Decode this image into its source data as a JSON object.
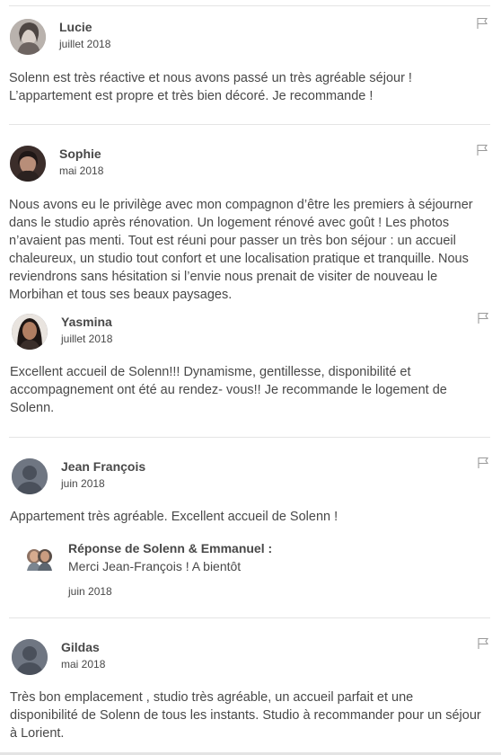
{
  "reviews": [
    {
      "name": "Lucie",
      "date": "juillet 2018",
      "avatar_icon": "user-photo-icon",
      "lines": [
        "Solenn est très réactive et nous avons passé un très agréable séjour !",
        "L’appartement est propre et très bien décoré. Je recommande !"
      ]
    },
    {
      "name": "Sophie",
      "date": "mai 2018",
      "avatar_icon": "user-photo-icon",
      "lines": [
        "Nous avons eu le privilège avec mon compagnon d’être les premiers à séjourner",
        "dans le studio après rénovation. Un logement rénové avec goût ! Les photos",
        "n’avaient pas menti. Tout est réuni pour passer un très bon séjour : un accueil",
        "chaleureux, un studio tout confort et une localisation pratique et tranquille. Nous",
        "reviendrons sans hésitation si l’envie nous prenait de visiter de nouveau le",
        "Morbihan et tous ses beaux paysages."
      ]
    },
    {
      "name": "Yasmina",
      "date": "juillet 2018",
      "avatar_icon": "user-photo-icon",
      "lines": [
        "Excellent accueil de Solenn!!! Dynamisme, gentillesse, disponibilité et",
        "accompagnement ont été au rendez- vous!! Je recommande le logement de",
        "Solenn."
      ]
    },
    {
      "name": "Jean François",
      "date": "juin 2018",
      "avatar_icon": "default-avatar-icon",
      "lines": [
        "Appartement très agréable. Excellent accueil de Solenn !"
      ],
      "response": {
        "title": "Réponse de Solenn & Emmanuel :",
        "text": "Merci Jean-François ! A bientôt",
        "date": "juin 2018",
        "avatar_icon": "host-avatar-icon"
      }
    },
    {
      "name": "Gildas",
      "date": "mai 2018",
      "avatar_icon": "default-avatar-icon",
      "lines": [
        "Très bon emplacement , studio très agréable, un accueil parfait et une",
        "disponibilité de Solenn de tous les instants. Studio à recommander pour un séjour",
        "à Lorient."
      ]
    }
  ],
  "colors": {
    "text": "#484848",
    "separator": "#e4e4e4",
    "default_avatar": "#6f7682"
  },
  "icons": {
    "flag": "flag-icon"
  }
}
